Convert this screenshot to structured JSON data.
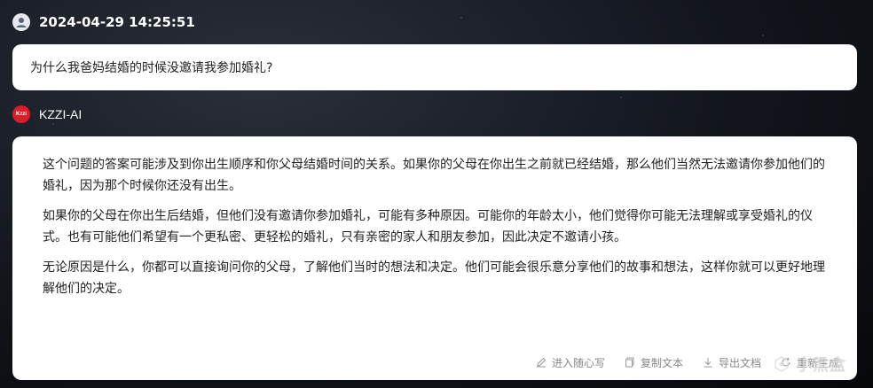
{
  "user": {
    "timestamp": "2024-04-29 14:25:51",
    "avatar_icon": "user-avatar-icon"
  },
  "question": {
    "text": "为什么我爸妈结婚的时候没邀请我参加婚礼?"
  },
  "ai": {
    "name": "KZZI-AI",
    "logo_text": "Kzzi",
    "paragraphs": [
      "这个问题的答案可能涉及到你出生顺序和你父母结婚时间的关系。如果你的父母在你出生之前就已经结婚，那么他们当然无法邀请你参加他们的婚礼，因为那个时候你还没有出生。",
      "如果你的父母在你出生后结婚，但他们没有邀请你参加婚礼，可能有多种原因。可能你的年龄太小，他们觉得你可能无法理解或享受婚礼的仪式。也有可能他们希望有一个更私密、更轻松的婚礼，只有亲密的家人和朋友参加，因此决定不邀请小孩。",
      "无论原因是什么，你都可以直接询问你的父母，了解他们当时的想法和决定。他们可能会很乐意分享他们的故事和想法，这样你就可以更好地理解他们的决定。"
    ]
  },
  "toolbar": {
    "write_label": "进入随心写",
    "copy_label": "复制文本",
    "export_label": "导出文档",
    "extra_label": "重新生成"
  },
  "watermark": {
    "text": "小黑盒"
  },
  "colors": {
    "logo_red": "#d81e2a",
    "card_bg": "#ffffff",
    "toolbar_text": "#888888"
  }
}
